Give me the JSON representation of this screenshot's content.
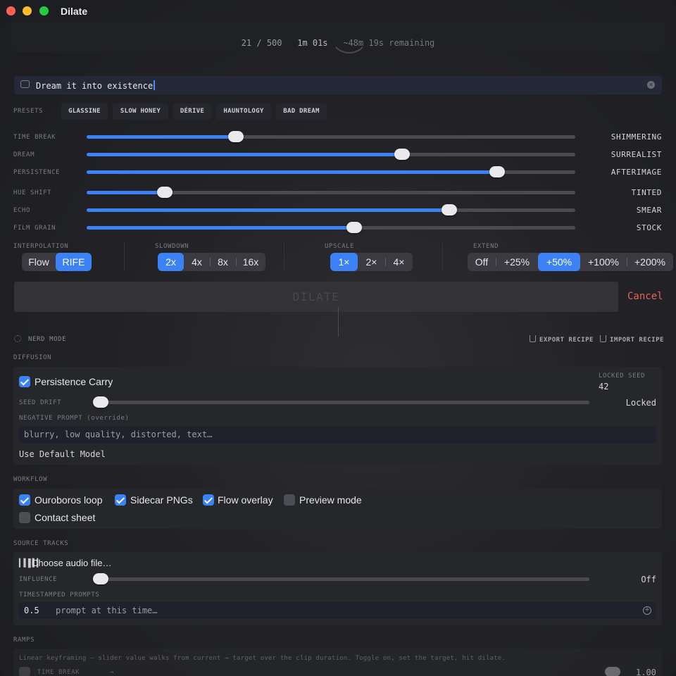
{
  "window": {
    "title": "Dilate"
  },
  "progress": {
    "counter": "21 / 500",
    "elapsed": "1m 01s",
    "remaining": "~48m 19s remaining"
  },
  "prompt": {
    "value": "Dream it into existence"
  },
  "presets": {
    "label": "PRESETS",
    "items": [
      "GLASSINE",
      "SLOW HONEY",
      "DÉRIVE",
      "HAUNTOLOGY",
      "BAD DREAM"
    ]
  },
  "sliders": [
    {
      "name": "TIME BREAK",
      "value": 0.305,
      "state": "SHIMMERING"
    },
    {
      "name": "DREAM",
      "value": 0.645,
      "state": "SURREALIST"
    },
    {
      "name": "PERSISTENCE",
      "value": 0.84,
      "state": "AFTERIMAGE"
    },
    {
      "name": "HUE SHIFT",
      "value": 0.16,
      "state": "TINTED"
    },
    {
      "name": "ECHO",
      "value": 0.742,
      "state": "SMEAR"
    },
    {
      "name": "FILM GRAIN",
      "value": 0.548,
      "state": "STOCK"
    }
  ],
  "interpolation": {
    "label": "INTERPOLATION",
    "options": [
      "Flow",
      "RIFE"
    ],
    "selected": "RIFE"
  },
  "slowdown": {
    "label": "SLOWDOWN",
    "options": [
      "2x",
      "4x",
      "8x",
      "16x"
    ],
    "selected": "2x"
  },
  "upscale": {
    "label": "UPSCALE",
    "options": [
      "1×",
      "2×",
      "4×"
    ],
    "selected": "1×"
  },
  "extend": {
    "label": "EXTEND",
    "options": [
      "Off",
      "+25%",
      "+50%",
      "+100%",
      "+200%"
    ],
    "selected": "+50%"
  },
  "actions": {
    "dilate": "DILATE",
    "cancel": "Cancel"
  },
  "nerd_mode": {
    "label": "NERD MODE",
    "export": "EXPORT RECIPE",
    "import": "IMPORT RECIPE"
  },
  "diffusion": {
    "title": "DIFFUSION",
    "persistence_carry": "Persistence Carry",
    "persistence_carry_checked": true,
    "locked_seed_label": "LOCKED SEED",
    "locked_seed_value": "42",
    "seed_drift_label": "SEED DRIFT",
    "seed_drift_value": 0.0,
    "seed_drift_state": "Locked",
    "negative_prompt_label": "NEGATIVE PROMPT (override)",
    "negative_prompt_placeholder": "blurry, low quality, distorted, text…",
    "model": "Use Default Model"
  },
  "workflow": {
    "title": "WORKFLOW",
    "items": [
      {
        "label": "Ouroboros loop",
        "checked": true
      },
      {
        "label": "Sidecar PNGs",
        "checked": true
      },
      {
        "label": "Flow overlay",
        "checked": true
      },
      {
        "label": "Preview mode",
        "checked": false
      },
      {
        "label": "Contact sheet",
        "checked": false
      }
    ]
  },
  "source_tracks": {
    "title": "SOURCE TRACKS",
    "choose_audio": "Choose audio file…",
    "influence_label": "INFLUENCE",
    "influence_value": 0.0,
    "influence_state": "Off",
    "timestamped_label": "TIMESTAMPED PROMPTS",
    "time_value": "0.5",
    "prompt_placeholder": "prompt at this time…"
  },
  "ramps": {
    "title": "RAMPS",
    "description": "Linear keyframing — slider value walks from current → target over the clip duration. Toggle on, set the target, hit dilate.",
    "row_name": "TIME BREAK",
    "arrow": "→",
    "target_value": "1.00"
  },
  "colors": {
    "accent": "#3b82f6",
    "cancel": "#e2645a",
    "close": "#ff5f57",
    "minimize": "#febc2e",
    "zoom": "#28c840"
  }
}
